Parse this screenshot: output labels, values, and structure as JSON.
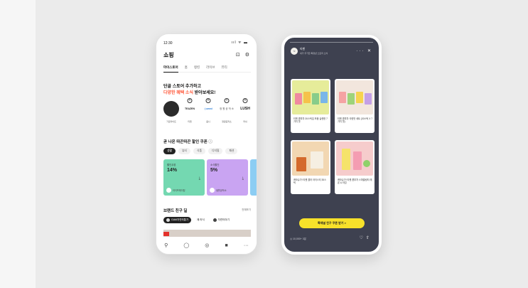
{
  "phone_left": {
    "status": {
      "time": "12:30",
      "signal": "ııl ᯤ ▬"
    },
    "title": "쇼핑",
    "header_icons": [
      "bag-icon",
      "gear-icon"
    ],
    "tabs": [
      "마이스토어",
      "홈",
      "랭킹",
      "라이브",
      "뷰티"
    ],
    "active_tab": "마이스토어",
    "heading_line1": "단골 스토어 추가하고",
    "heading_line2_accent": "다양한 혜택 소식",
    "heading_line2_rest": " 받아보세요!",
    "brands": [
      {
        "logo": "",
        "name": "가로마이트",
        "color": "#2b2b2b"
      },
      {
        "logo": "TEAZEN",
        "name": "티젠",
        "color": "#ffffff"
      },
      {
        "logo": "◎omni",
        "name": "옴니",
        "color": "#ffffff"
      },
      {
        "logo": "정 원\n공 작 소",
        "name": "정원공작소",
        "color": "#ffffff"
      },
      {
        "logo": "LUSH",
        "name": "러쉬",
        "color": "#ffffff"
      }
    ],
    "coupon_title": "곧 나온 따끈따끈 할인 쿠폰",
    "coupon_chips": [
      "생활",
      "뷰티",
      "식품",
      "디지털",
      "패션"
    ],
    "active_chip": "생활",
    "coupons": [
      {
        "label": "할인쿠폰",
        "value": "14%",
        "brand": "라이프에이징",
        "color": "#74d8b1"
      },
      {
        "label": "소식할인",
        "value": "5%",
        "brand": "생활공작소",
        "color": "#c9a4f2"
      },
      {
        "label": "",
        "value": "",
        "brand": "",
        "color": "#8ccdf3"
      }
    ],
    "friends_title": "브랜드 친구 딜",
    "friends_more": "전체보기",
    "friends": [
      "GAM자연의통가",
      "제 라식",
      "자연이야기"
    ],
    "nav_icons": [
      "person-icon",
      "chat-icon",
      "coin-icon",
      "bag-icon",
      "more-icon"
    ]
  },
  "phone_right": {
    "account_name": "티젠",
    "account_sub": "내가 추가한 특정샵 스토리 소식",
    "actions": "··· ✕",
    "cards": [
      {
        "caption": "티젠 콤부차 30스틱입 모음 실렌한 7가지 맛",
        "bg": "#e6ec9a"
      },
      {
        "caption": "티젠 콤부차 극한맛 세트 (30스틱 X 7가지 맛)",
        "bg": "#f2e6dd"
      },
      {
        "caption": "캐모슈가! 티젠 콜라 아이스티 30스틱",
        "bg": "#f2d7b2"
      },
      {
        "caption": "캐모슈가! 티젠 콤부차 스파클링티 레몬 & 라임",
        "bg": "#f6cccc"
      }
    ],
    "cta_label": "톡채널 친구 쿠폰 받기 >",
    "views": "◎ 10,000+ 3분",
    "bottom_icons": [
      "heart-icon",
      "share-icon"
    ]
  }
}
